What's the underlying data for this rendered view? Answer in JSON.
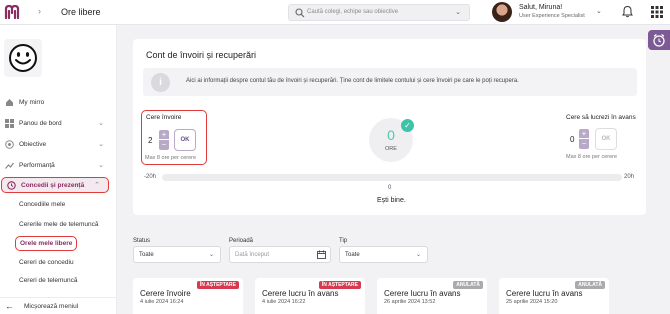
{
  "topbar": {
    "page_title": "Ore libere",
    "search_placeholder": "Caută colegi, echipe sau obiective",
    "user_greeting": "Salut, Miruna!",
    "user_role": "User Experience Specialist"
  },
  "sidebar": {
    "items": [
      {
        "label": "My mirro",
        "icon": "home-icon"
      },
      {
        "label": "Panou de bord",
        "icon": "dashboard-icon"
      },
      {
        "label": "Obiective",
        "icon": "target-icon"
      },
      {
        "label": "Performanță",
        "icon": "trend-icon"
      },
      {
        "label": "Concedii și prezență",
        "icon": "clock-icon"
      }
    ],
    "subitems": [
      {
        "label": "Concediile mele"
      },
      {
        "label": "Cererile mele de telemuncă"
      },
      {
        "label": "Orele mele libere"
      },
      {
        "label": "Cereri de concediu"
      },
      {
        "label": "Cereri de telemuncă"
      }
    ],
    "collapse_label": "Micșorează meniul"
  },
  "card": {
    "title": "Cont de învoiri și recuperări",
    "info_text": "Aici ai informații despre contul tău de învoiri și recuperări. Ține cont de limitele contului și cere învoiri pe care le poți recupera.",
    "leave_request": {
      "label": "Cere învoire",
      "value": "2",
      "ok_label": "OK",
      "hint": "Max 8 ore per cerere"
    },
    "balance": {
      "value": "0",
      "unit": "ORE"
    },
    "work_request": {
      "label": "Cere să lucrezi în avans",
      "value": "0",
      "ok_label": "OK",
      "hint": "Max 8 ore per cerere"
    },
    "range_min": "-20h",
    "range_max": "20h",
    "range_zero": "0",
    "status_message": "Ești bine."
  },
  "filters": {
    "status": {
      "label": "Status",
      "value": "Toate"
    },
    "period": {
      "label": "Perioadă",
      "placeholder": "Dată început"
    },
    "type": {
      "label": "Tip",
      "value": "Toate"
    }
  },
  "requests": [
    {
      "title": "Cerere învoire",
      "date": "4 iulie 2024 16:24",
      "badge": "ÎN AȘTEPTARE",
      "badge_type": "pending"
    },
    {
      "title": "Cerere lucru în avans",
      "date": "4 iulie 2024 16:22",
      "badge": "ÎN AȘTEPTARE",
      "badge_type": "pending"
    },
    {
      "title": "Cerere lucru în avans",
      "date": "26 aprilie 2024 13:52",
      "badge": "ANULATĂ",
      "badge_type": "cancelled"
    },
    {
      "title": "Cerere lucru în avans",
      "date": "25 aprilie 2024 15:20",
      "badge": "ANULATĂ",
      "badge_type": "cancelled"
    }
  ],
  "colors": {
    "brand": "#8a2d62",
    "accent": "#4cc9b0",
    "highlight": "#e03a3a",
    "pending": "#d53a4e",
    "cancelled": "#a9a9ae"
  }
}
